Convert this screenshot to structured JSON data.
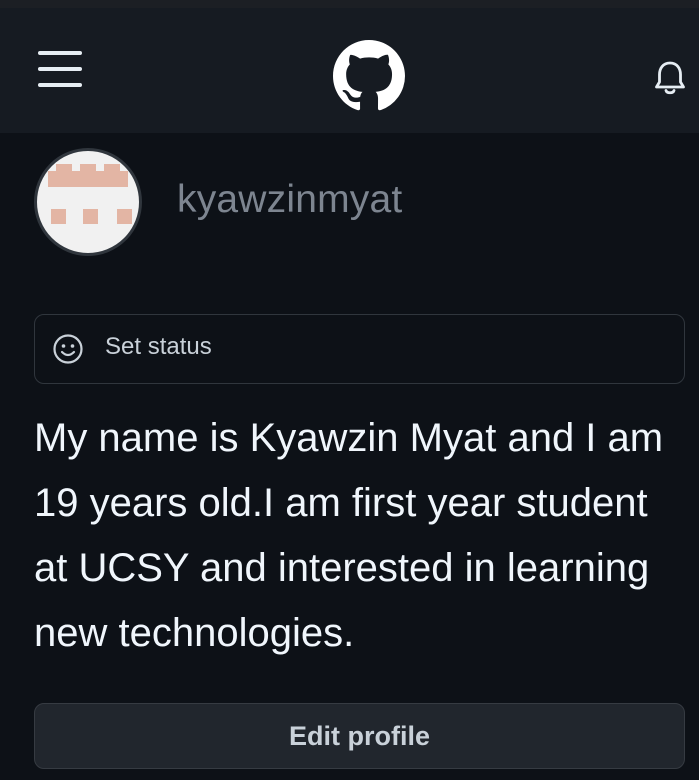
{
  "header": {
    "menu_icon": "hamburger-menu-icon",
    "logo_icon": "github-octocat-logo",
    "notifications_icon": "bell-icon"
  },
  "profile": {
    "username": "kyawzinmyat",
    "avatar_icon": "identicon-avatar",
    "status": {
      "icon": "smiley-face-icon",
      "label": "Set status"
    },
    "bio": "My name is Kyawzin Myat and I am 19 years old.I am first year student at UCSY and interested in learning new technologies.",
    "edit_button_label": "Edit profile"
  },
  "colors": {
    "background": "#0d1117",
    "header_background": "#161b22",
    "border": "#30363d",
    "button_background": "#21262d",
    "primary_text": "#f0f6fc",
    "muted_text": "#7d8590",
    "avatar_accent": "#e3b5a4"
  }
}
